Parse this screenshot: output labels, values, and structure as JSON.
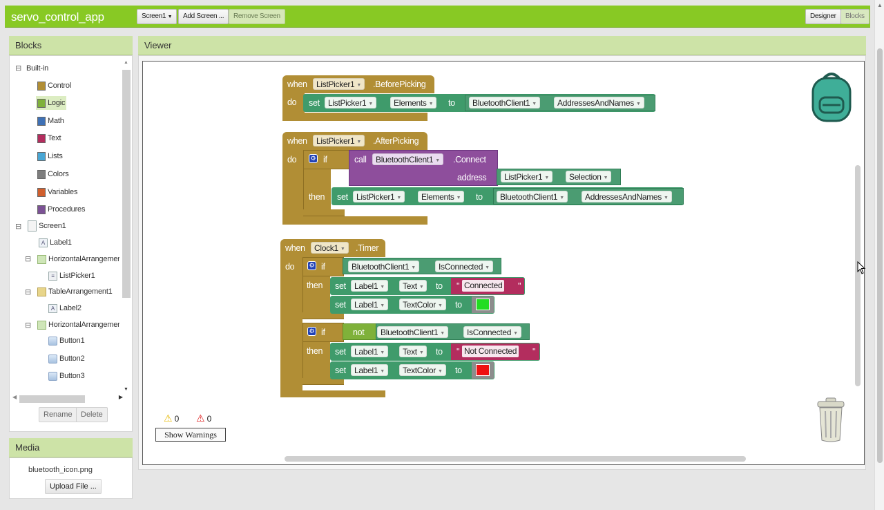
{
  "app": {
    "title": "servo_control_app"
  },
  "toolbar": {
    "screen_select": "Screen1",
    "add_screen": "Add Screen ...",
    "remove_screen": "Remove Screen",
    "designer": "Designer",
    "blocks": "Blocks"
  },
  "blocks_panel": {
    "title": "Blocks",
    "builtin_label": "Built-in",
    "builtin": [
      {
        "label": "Control",
        "color": "#b18e35"
      },
      {
        "label": "Logic",
        "color": "#7fb13a"
      },
      {
        "label": "Math",
        "color": "#3f71b5"
      },
      {
        "label": "Text",
        "color": "#b32d5e"
      },
      {
        "label": "Lists",
        "color": "#49a6d4"
      },
      {
        "label": "Colors",
        "color": "#7d7d7d"
      },
      {
        "label": "Variables",
        "color": "#d05f2d"
      },
      {
        "label": "Procedures",
        "color": "#7c5295"
      }
    ],
    "screen": "Screen1",
    "components": [
      "Label1",
      "HorizontalArrangemer",
      "ListPicker1",
      "TableArrangement1",
      "Label2",
      "HorizontalArrangemer",
      "Button1",
      "Button2",
      "Button3"
    ],
    "rename": "Rename",
    "delete": "Delete"
  },
  "media": {
    "title": "Media",
    "file": "bluetooth_icon.png",
    "upload": "Upload File ..."
  },
  "viewer": {
    "title": "Viewer"
  },
  "blockly": {
    "when": "when",
    "do": "do",
    "set": "set",
    "to": "to",
    "call": "call",
    "if": "if",
    "then": "then",
    "address": "address",
    "not": "not",
    "listpicker": "ListPicker1",
    "bluetooth": "BluetoothClient1",
    "label": "Label1",
    "clock": "Clock1",
    "before_picking": ".BeforePicking",
    "after_picking": ".AfterPicking",
    "timer": ".Timer",
    "connect": ".Connect",
    "elements": "Elements",
    "addresses": "AddressesAndNames",
    "selection": "Selection",
    "is_connected": "IsConnected",
    "text": "Text",
    "text_color": "TextColor",
    "connected": "Connected",
    "not_connected": "Not Connected",
    "quote": "\"",
    "green": "#22dd22",
    "red": "#ee1111"
  },
  "warnings": {
    "warn_count": "0",
    "error_count": "0",
    "show": "Show Warnings"
  }
}
